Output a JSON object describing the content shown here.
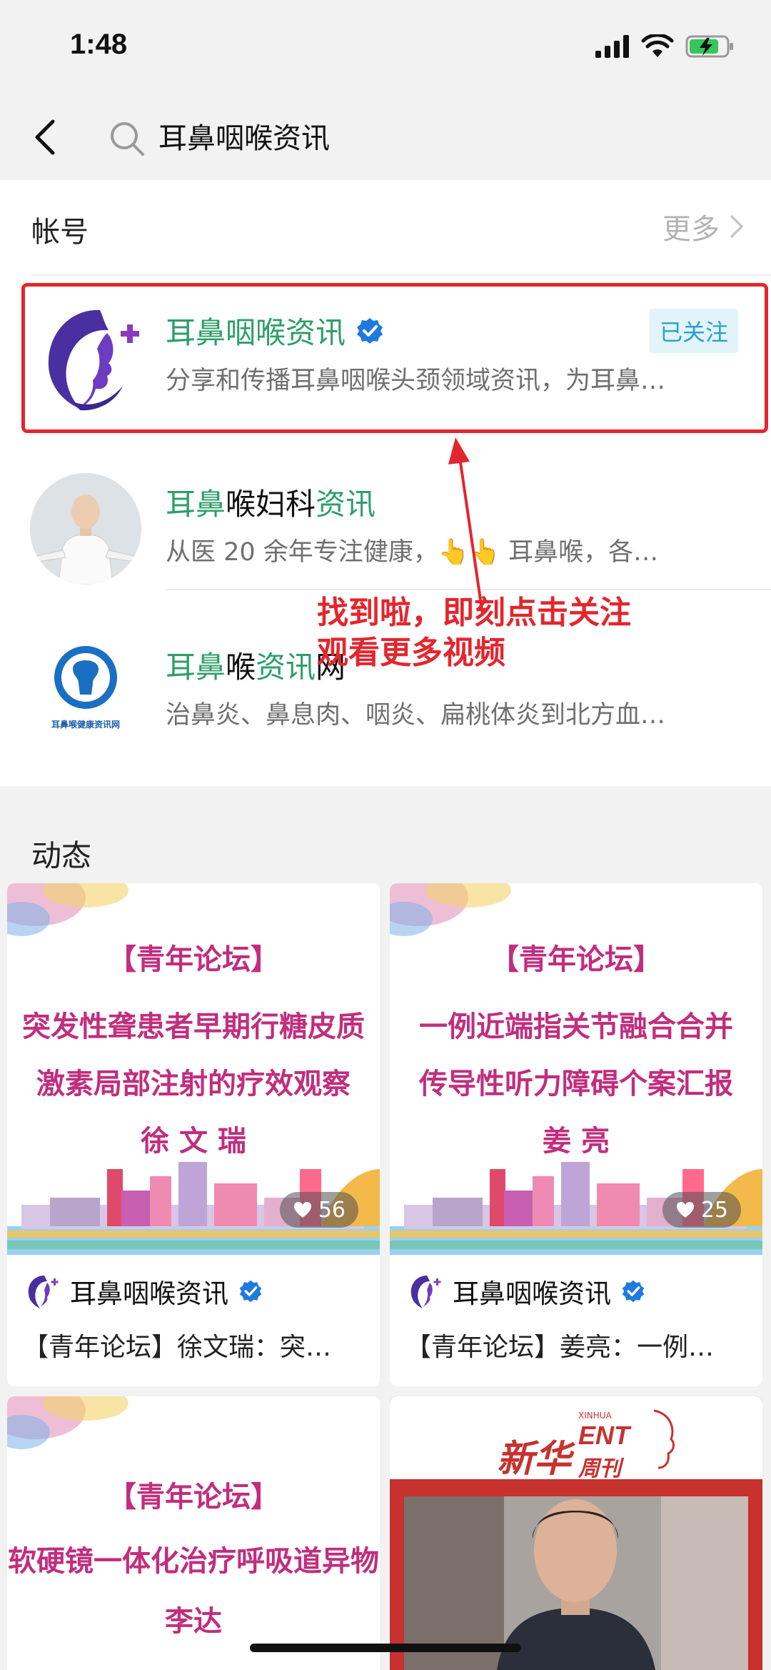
{
  "status": {
    "time": "1:48"
  },
  "search": {
    "query": "耳鼻咽喉资讯"
  },
  "accounts": {
    "title": "帐号",
    "more": "更多",
    "items": [
      {
        "name_hl": "耳鼻咽喉资讯",
        "name_rest": "",
        "desc": "分享和传播耳鼻咽喉头颈领域资讯，为耳鼻…",
        "verified": true,
        "follow_label": "已关注"
      },
      {
        "name_hl": "耳鼻",
        "name_mid": "喉妇科",
        "name_hl2": "资讯",
        "desc": "从医 20 余年专注健康，👆👆 耳鼻喉，各…"
      },
      {
        "name_hl": "耳鼻",
        "name_mid": "喉",
        "name_hl2": "资讯",
        "name_rest": "网",
        "desc": "治鼻炎、鼻息肉、咽炎、扁桃体炎到北方血…",
        "logo_text": "耳鼻喉健康资讯网"
      }
    ]
  },
  "annotation": {
    "line1": "找到啦，即刻点击关注",
    "line2": "观看更多视频"
  },
  "feed": {
    "title": "动态",
    "cards": [
      {
        "tag": "【青年论坛】",
        "line1": "突发性聋患者早期行糖皮质",
        "line2": "激素局部注射的疗效观察",
        "line3": "徐 文 瑞",
        "likes": "56",
        "author": "耳鼻咽喉资讯",
        "caption": "【青年论坛】徐文瑞：突…"
      },
      {
        "tag": "【青年论坛】",
        "line1": "一例近端指关节融合合并",
        "line2": "传导性听力障碍个案汇报",
        "line3": "姜 亮",
        "likes": "25",
        "author": "耳鼻咽喉资讯",
        "caption": "【青年论坛】姜亮：一例…"
      },
      {
        "tag": "【青年论坛】",
        "line1": "软硬镜一体化治疗呼吸道异物",
        "line2": "李达"
      },
      {
        "brand_cn": "新华",
        "brand_small": "XINHUA",
        "brand_en": "ENT",
        "brand_sub": "周刊"
      }
    ]
  },
  "colors": {
    "accent_green": "#2e9e6a",
    "annotation_red": "#e3262d",
    "verified_blue": "#1f7ae0",
    "tag_magenta": "#c12e7e"
  }
}
